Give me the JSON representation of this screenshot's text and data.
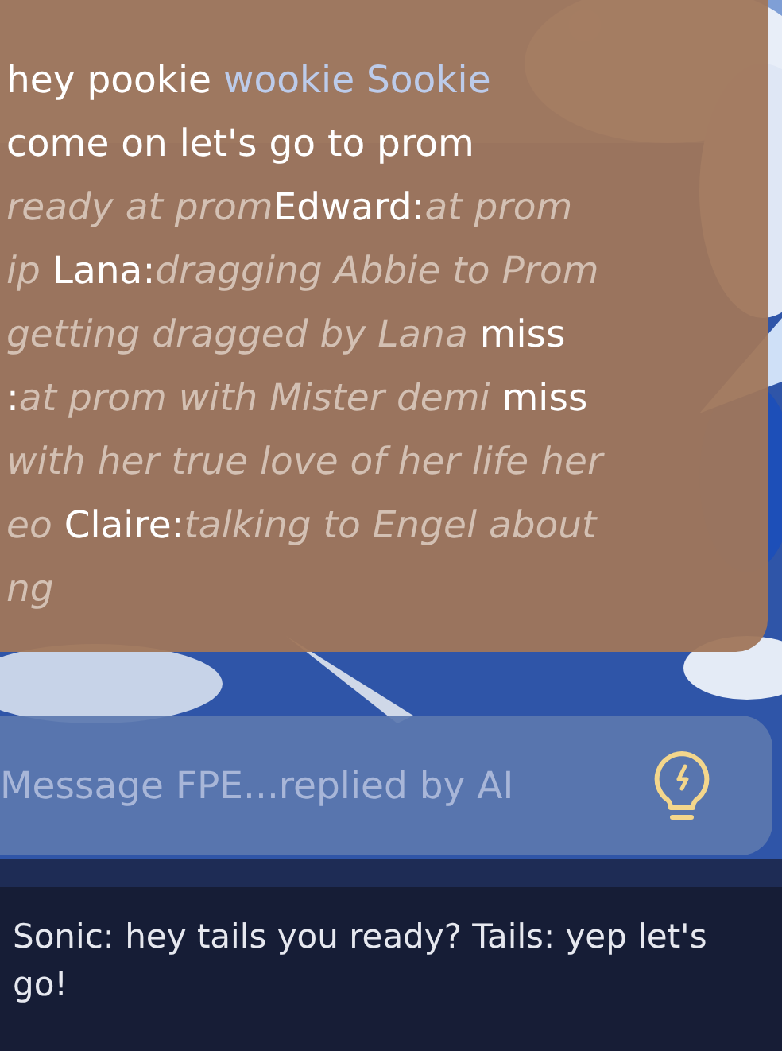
{
  "story_lines": [
    [
      {
        "kind": "plain",
        "text": "hey pookie "
      },
      {
        "kind": "highlight",
        "text": "wookie Sookie"
      }
    ],
    [
      {
        "kind": "plain",
        "text": "come on let's go to prom"
      }
    ],
    [
      {
        "kind": "action",
        "text": "ready at prom"
      },
      {
        "kind": "name",
        "text": "Edward:"
      },
      {
        "kind": "action",
        "text": "at prom"
      }
    ],
    [
      {
        "kind": "action",
        "text": "ip "
      },
      {
        "kind": "name",
        "text": "Lana:"
      },
      {
        "kind": "action",
        "text": "dragging Abbie to Prom"
      }
    ],
    [
      {
        "kind": "action",
        "text": "getting dragged by Lana "
      },
      {
        "kind": "name",
        "text": "miss"
      }
    ],
    [
      {
        "kind": "name",
        "text": ":"
      },
      {
        "kind": "action",
        "text": "at prom with Mister demi "
      },
      {
        "kind": "name",
        "text": "miss"
      }
    ],
    [
      {
        "kind": "action",
        "text": "with her true love of her life her"
      }
    ],
    [
      {
        "kind": "action",
        "text": "eo "
      },
      {
        "kind": "name",
        "text": "Claire:"
      },
      {
        "kind": "action",
        "text": "talking to Engel about"
      }
    ],
    [
      {
        "kind": "action",
        "text": "ng"
      }
    ]
  ],
  "message_input": {
    "placeholder": "Message FPE...replied by AI"
  },
  "scene_prompt": "Sonic: hey tails you ready? Tails: yep let's go!"
}
